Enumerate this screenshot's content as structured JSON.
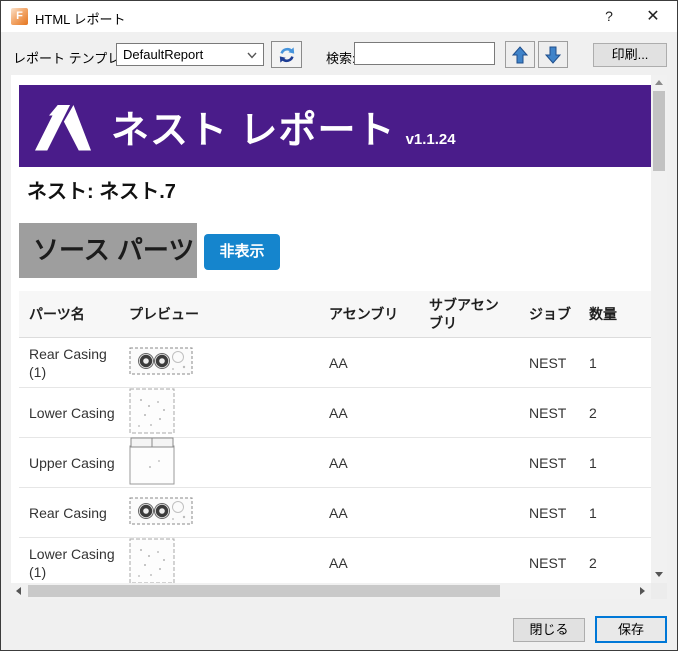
{
  "window": {
    "title": "HTML レポート",
    "help_label": "?",
    "close_glyph": "✕",
    "app_icon_letter": "F"
  },
  "toolbar": {
    "template_label": "レポート テンプレート:",
    "template_value": "DefaultReport",
    "search_label": "検索:",
    "search_value": "",
    "print_label": "印刷..."
  },
  "report": {
    "banner": {
      "title": "ネスト レポート",
      "version": "v1.1.24"
    },
    "heading": "ネスト: ネスト.7",
    "section": {
      "title": "ソース パーツ",
      "hide_button_label": "非表示"
    },
    "table": {
      "headers": [
        "パーツ名",
        "プレビュー",
        "アセンブリ",
        "サブアセンブリ",
        "ジョブ",
        "数量"
      ],
      "rows": [
        {
          "name": "Rear Casing (1)",
          "preview": "rear-casing",
          "assembly": "AA",
          "subassembly": "",
          "job": "NEST",
          "qty": "1"
        },
        {
          "name": "Lower Casing",
          "preview": "lower-casing",
          "assembly": "AA",
          "subassembly": "",
          "job": "NEST",
          "qty": "2"
        },
        {
          "name": "Upper Casing",
          "preview": "upper-casing",
          "assembly": "AA",
          "subassembly": "",
          "job": "NEST",
          "qty": "1"
        },
        {
          "name": "Rear Casing",
          "preview": "rear-casing",
          "assembly": "AA",
          "subassembly": "",
          "job": "NEST",
          "qty": "1"
        },
        {
          "name": "Lower Casing (1)",
          "preview": "lower-casing",
          "assembly": "AA",
          "subassembly": "",
          "job": "NEST",
          "qty": "2"
        }
      ]
    }
  },
  "footer": {
    "close_label": "閉じる",
    "save_label": "保存"
  },
  "colors": {
    "banner_bg": "#4A1C8A",
    "hide_button_bg": "#1585CD",
    "save_border": "#0078D7",
    "arrow_blue": "#3F83C9",
    "refresh_light_blue": "#4694DC",
    "refresh_dark_blue": "#1D3D94"
  }
}
